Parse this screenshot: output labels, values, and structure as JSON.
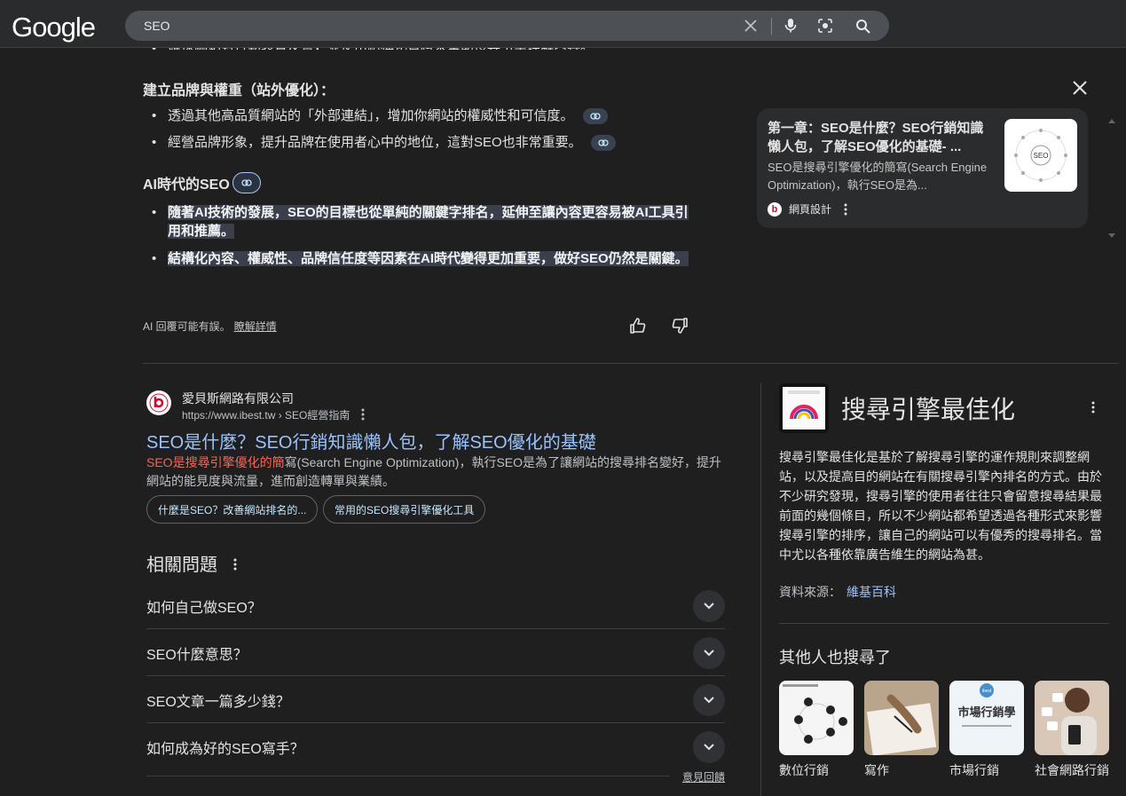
{
  "header": {
    "logo": "Google",
    "query": "SEO"
  },
  "ai_overview": {
    "cut_line": "確保網站對行動裝置友善，並使用結構化資料來幫助搜尋引擎理解內容。",
    "section1_heading": "建立品牌與權重（站外優化）：",
    "section1_bullets": [
      "透過其他高品質網站的「外部連結」，增加你網站的權威性和可信度。",
      "經營品牌形象，提升品牌在使用者心中的地位，這對SEO也非常重要。"
    ],
    "section2_heading": "AI時代的SEO",
    "section2_bullets": [
      "隨著AI技術的發展，SEO的目標也從單純的關鍵字排名，延伸至讓內容更容易被AI工具引用和推薦。",
      "結構化內容、權威性、品牌信任度等因素在AI時代變得更加重要，做好SEO仍然是關鍵。"
    ],
    "note": "AI 回覆可能有誤。",
    "learn_more": "瞭解詳情"
  },
  "source_card": {
    "title": "第一章：SEO是什麼？SEO行銷知識懶人包，了解SEO優化的基礎- ...",
    "description": "SEO是搜尋引擎優化的簡寫(Search Engine Optimization)，執行SEO是為...",
    "site": "網頁設計",
    "thumb_text": "SEO"
  },
  "result": {
    "site_name": "愛貝斯網路有限公司",
    "url": "https://www.ibest.tw › SEO經營指南",
    "title": "SEO是什麼？SEO行銷知識懶人包，了解SEO優化的基礎",
    "snippet_em": "SEO是搜尋引擎優化的簡",
    "snippet_rest": "寫(Search Engine Optimization)，執行SEO是為了讓網站的搜尋排名變好，提升網站的能見度與流量，進而創造轉單與業績。",
    "pills": [
      "什麼是SEO？改善網站排名的...",
      "常用的SEO搜尋引擎優化工具"
    ]
  },
  "paa": {
    "heading": "相關問題",
    "questions": [
      "如何自己做SEO？",
      "SEO什麼意思？",
      "SEO文章一篇多少錢？",
      "如何成為好的SEO寫手？"
    ],
    "feedback": "意見回饋"
  },
  "knowledge_panel": {
    "title": "搜尋引擎最佳化",
    "description": "搜尋引擎最佳化是基於了解搜尋引擎的運作規則來調整網站，以及提高目的網站在有關搜尋引擎內排名的方式。由於不少研究發現，搜尋引擎的使用者往往只會留意搜尋結果最前面的幾個條目，所以不少網站都希望透過各種形式來影響搜尋引擎的排序，讓自己的網站可以有優秀的搜尋排名。當中尤以各種依靠廣告維生的網站為甚。",
    "source_label": "資料來源：",
    "source_link": "維基百科",
    "others_heading": "其他人也搜尋了",
    "others": [
      {
        "label": "數位行銷"
      },
      {
        "label": "寫作"
      },
      {
        "label": "市場行銷",
        "image_text": "市場行銷學"
      },
      {
        "label": "社會網路行銷"
      }
    ]
  },
  "colors": {
    "background": "#1f1f1f",
    "link": "#99c3ff",
    "highlight": "#ee675c"
  }
}
